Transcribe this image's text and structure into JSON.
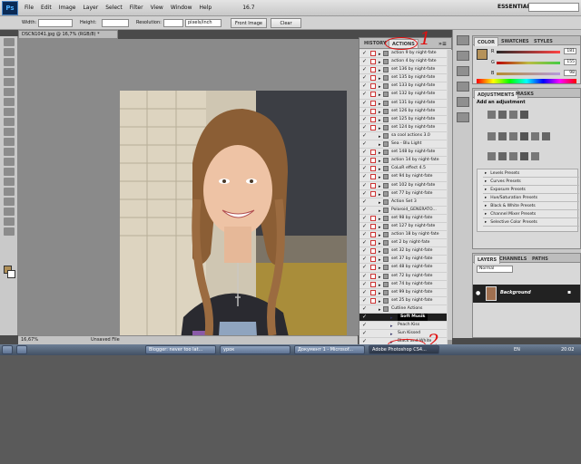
{
  "menubar": {
    "logo": "Ps",
    "items": [
      "File",
      "Edit",
      "Image",
      "Layer",
      "Select",
      "Filter",
      "View",
      "Window",
      "Help"
    ],
    "zoom": "16.7",
    "workspace": "ESSENTIALS"
  },
  "options": {
    "width_label": "Width:",
    "height_label": "Height:",
    "resolution_label": "Resolution:",
    "resolution_unit": "pixels/inch",
    "front_image": "Front Image",
    "clear": "Clear"
  },
  "document": {
    "tab_title": "DSCN1041.jpg @ 16,7% (RGB/8) *",
    "zoom": "16,67%",
    "status": "Unsaved File"
  },
  "actions_panel": {
    "tabs": [
      "HISTORY",
      "ACTIONS"
    ],
    "rows": [
      {
        "label": "action 9 by night-fate",
        "sub": false,
        "dialog": true
      },
      {
        "label": "action 4 by night-fate",
        "sub": false,
        "dialog": true
      },
      {
        "label": "set 136 by night-fate",
        "sub": false,
        "dialog": true
      },
      {
        "label": "set 135 by night-fate",
        "sub": false,
        "dialog": true
      },
      {
        "label": "set 133 by night-fate",
        "sub": false,
        "dialog": true
      },
      {
        "label": "set 132 by night-fate",
        "sub": false,
        "dialog": true
      },
      {
        "label": "set 131 by night-fate",
        "sub": false,
        "dialog": true
      },
      {
        "label": "set 126 by night-fate",
        "sub": false,
        "dialog": true
      },
      {
        "label": "set 125 by night-fate",
        "sub": false,
        "dialog": true
      },
      {
        "label": "set 124 by night-fate",
        "sub": false,
        "dialog": true
      },
      {
        "label": "sa cool actions 3.0",
        "sub": false,
        "dialog": false
      },
      {
        "label": "Sea - Blu Light",
        "sub": false,
        "dialog": false
      },
      {
        "label": "set 148 by night-fate",
        "sub": false,
        "dialog": true
      },
      {
        "label": "action 14 by night-fate",
        "sub": false,
        "dialog": true
      },
      {
        "label": "CoLoR effect 4.5",
        "sub": false,
        "dialog": true
      },
      {
        "label": "set 94 by night-fate",
        "sub": false,
        "dialog": true
      },
      {
        "label": "set 102 by night-fate",
        "sub": false,
        "dialog": true
      },
      {
        "label": "set 77 by night-fate",
        "sub": false,
        "dialog": true
      },
      {
        "label": "Action Set 3",
        "sub": false,
        "dialog": false
      },
      {
        "label": "Polaroid_GENERATO...",
        "sub": false,
        "dialog": false
      },
      {
        "label": "set 98 by night-fate",
        "sub": false,
        "dialog": true
      },
      {
        "label": "set 127 by night-fate",
        "sub": false,
        "dialog": true
      },
      {
        "label": "action 18 by night-fate",
        "sub": false,
        "dialog": true
      },
      {
        "label": "set 2 by night-fate",
        "sub": false,
        "dialog": true
      },
      {
        "label": "set 32 by night-fate",
        "sub": false,
        "dialog": true
      },
      {
        "label": "set 37 by night-fate",
        "sub": false,
        "dialog": true
      },
      {
        "label": "set 48 by night-fate",
        "sub": false,
        "dialog": true
      },
      {
        "label": "set 72 by night-fate",
        "sub": false,
        "dialog": true
      },
      {
        "label": "set 74 by night-fate",
        "sub": false,
        "dialog": true
      },
      {
        "label": "set 99 by night-fate",
        "sub": false,
        "dialog": true
      },
      {
        "label": "set 25 by night-fate",
        "sub": false,
        "dialog": true
      },
      {
        "label": "Cutline Actions",
        "sub": false,
        "dialog": false
      },
      {
        "label": "Soft Musik",
        "sub": true,
        "dialog": false,
        "selected": true
      },
      {
        "label": "Peach Kiss",
        "sub": true,
        "dialog": false
      },
      {
        "label": "Sun Kissed",
        "sub": true,
        "dialog": false
      },
      {
        "label": "Black and White",
        "sub": true,
        "dialog": false
      },
      {
        "label": "RAW Definition",
        "sub": true,
        "dialog": false
      }
    ],
    "annotations": [
      "1",
      "2",
      "3"
    ]
  },
  "color_panel": {
    "tabs": [
      "COLOR",
      "SWATCHES",
      "STYLES"
    ],
    "r": "181",
    "g": "155",
    "b": "98",
    "r_label": "R",
    "g_label": "G",
    "b_label": "B"
  },
  "adjustments_panel": {
    "tabs": [
      "ADJUSTMENTS",
      "MASKS"
    ],
    "title": "Add an adjustment",
    "presets": [
      "Levels Presets",
      "Curves Presets",
      "Exposure Presets",
      "Hue/Saturation Presets",
      "Black & White Presets",
      "Channel Mixer Presets",
      "Selective Color Presets"
    ]
  },
  "layers_panel": {
    "tabs": [
      "LAYERS",
      "CHANNELS",
      "PATHS"
    ],
    "blend_mode": "Normal",
    "layer_name": "Background"
  },
  "taskbar": {
    "items": [
      "",
      "Blogger: never too lat...",
      "урок",
      "Документ 1 - Microsof...",
      "Adobe Photoshop CS4...",
      ""
    ],
    "lang": "EN",
    "clock": "20:02"
  },
  "colors": {
    "foreground": "#b5925a",
    "accent_red": "#e01010"
  }
}
